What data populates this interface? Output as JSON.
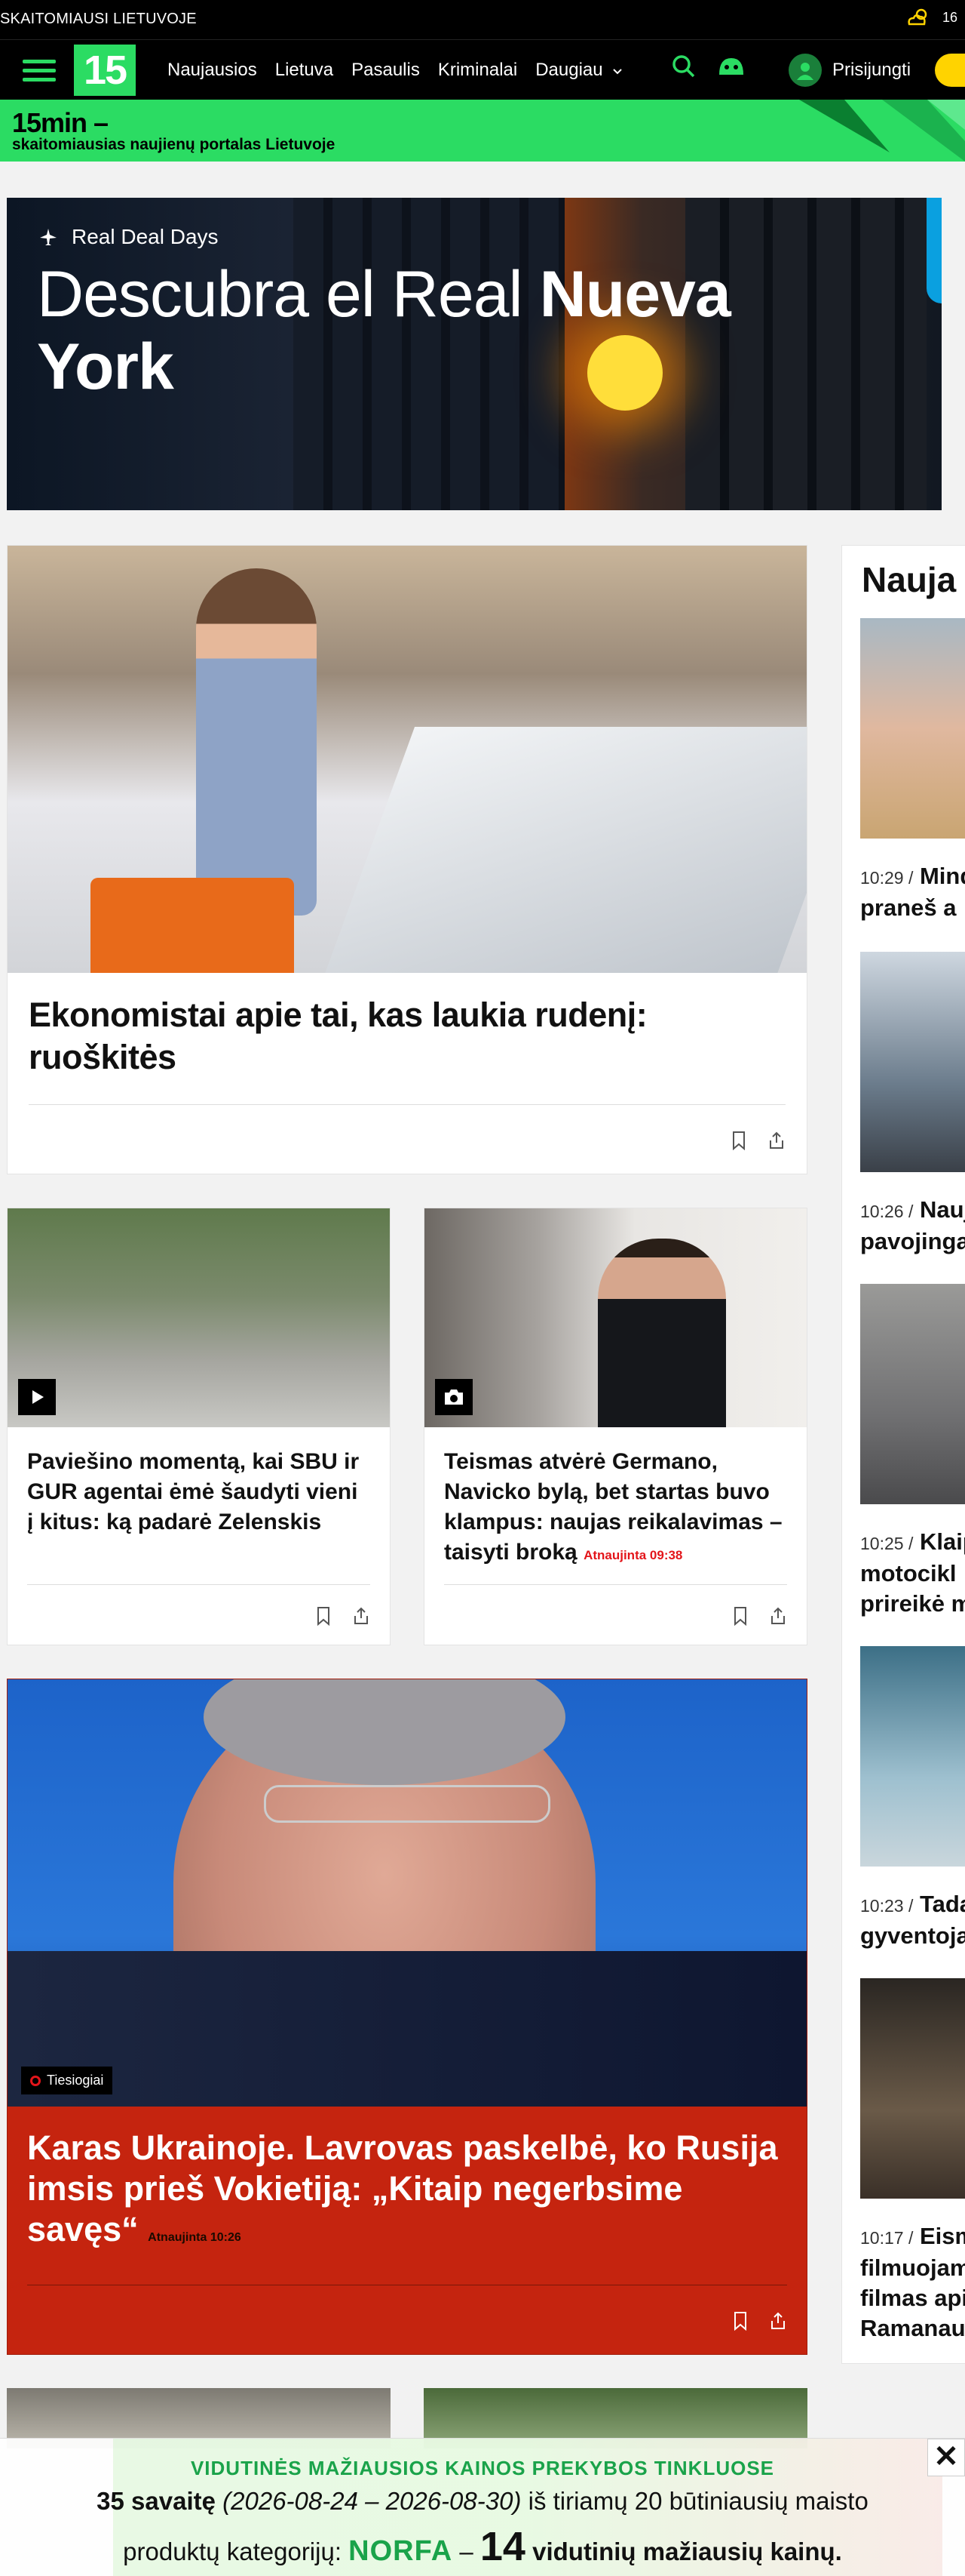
{
  "topbar": {
    "tagline": "SKAITOMIAUSI LIETUVOJE",
    "weather_temp": "16"
  },
  "nav": {
    "logo": "15",
    "links": [
      "Naujausios",
      "Lietuva",
      "Pasaulis",
      "Kriminalai",
      "Daugiau"
    ],
    "login": "Prisijungti"
  },
  "brand": {
    "name": "15min –",
    "slogan": "skaitomiausias naujienų portalas Lietuvoje"
  },
  "ad": {
    "sub": "Real Deal Days",
    "title_a": "Descubra el Real ",
    "title_b": "Nueva",
    "title_c": "York"
  },
  "articles": {
    "main": {
      "title": "Ekonomistai apie tai, kas laukia rudenį: ruoškitės"
    },
    "a2": {
      "title": "Paviešino momentą, kai SBU ir GUR agentai ėmė šaudyti vieni į kitus: ką padarė Zelenskis"
    },
    "a3": {
      "title": "Teismas atvėrė Germano, Navicko bylą, bet startas buvo klampus: naujas reikalavimas – taisyti broką",
      "updated": "Atnaujinta 09:38"
    },
    "a4": {
      "title": "Karas Ukrainoje. Lavrovas paskelbė, ko Rusija imsis prieš Vokietiją: „Kitaip negerbsime savęs“",
      "updated": "Atnaujinta 10:26",
      "badge": "Tiesiogiai"
    }
  },
  "sidebar": {
    "heading": "Nauja",
    "items": [
      {
        "time": "10:29 /",
        "line1": "Mind",
        "line2": "praneš a"
      },
      {
        "time": "10:26 /",
        "line1": "Nauj",
        "line2": "pavojinga"
      },
      {
        "time": "10:25 /",
        "line1": "Klaip",
        "line2": "motocikl",
        "line3": "prireikė m"
      },
      {
        "time": "10:23 /",
        "line1": "Tada",
        "line2": "gyventoja"
      },
      {
        "time": "10:17 /",
        "line1": "Eism",
        "line2": "filmuojam",
        "line3": "filmas api",
        "line4": "Ramanaus"
      }
    ]
  },
  "bottom_ad": {
    "line1": "VIDUTINĖS MAŽIAUSIOS KAINOS PREKYBOS TINKLUOSE",
    "week": "35 savaitę",
    "range": "(2026-08-24 – 2026-08-30)",
    "rest": " iš tiriamų 20 būtiniausių maisto",
    "line3a": "produktų kategorijų: ",
    "brand": "NORFA",
    "dash": " – ",
    "count": "14",
    "line3b": " vidutinių mažiausių kainų.",
    "close": "✕"
  },
  "colors": {
    "accent": "#2bdc63",
    "live_red": "#c5240f",
    "brand_yellow": "#ffd300"
  }
}
